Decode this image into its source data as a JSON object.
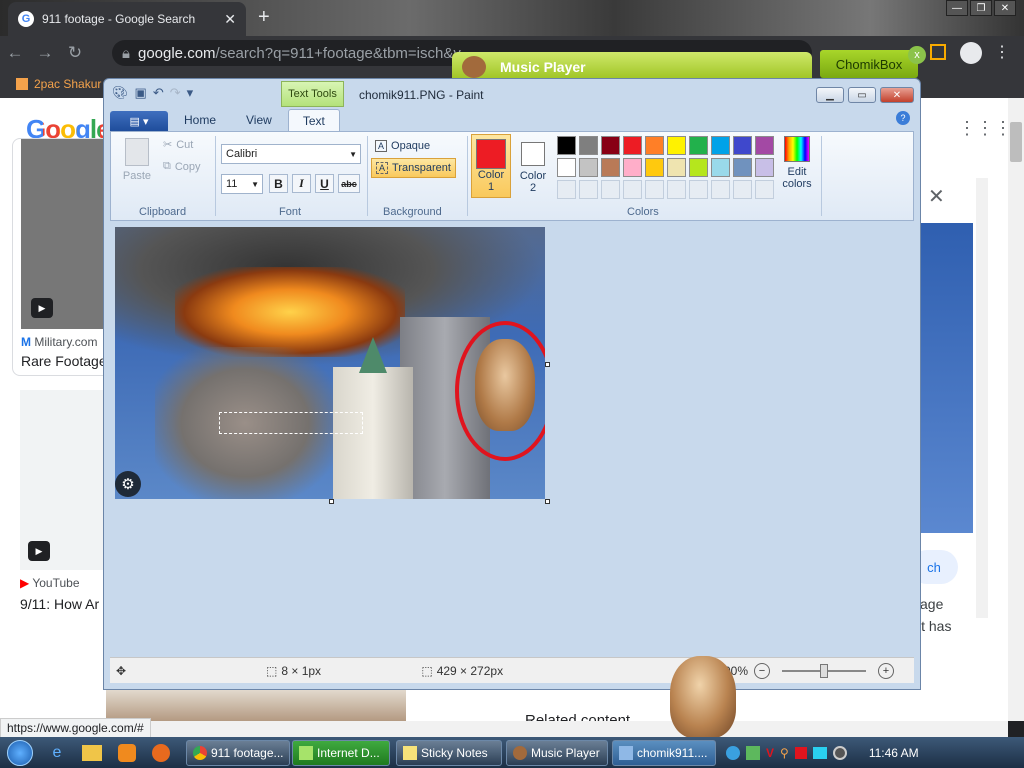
{
  "browser": {
    "tab_title": "911 footage - Google Search",
    "tab_close": "✕",
    "new_tab": "+",
    "omnibox_domain": "google.com",
    "omnibox_path": "/search?q=911+footage&tbm=isch&v...",
    "bookmark_label": "2pac Shakur",
    "status_url": "https://www.google.com/#"
  },
  "google": {
    "logo": "Google",
    "result1_source": "Military.com",
    "result1_title": "Rare Footage",
    "result2_source": "YouTube",
    "result2_title": "9/11: How Ar",
    "right_btn": "ch",
    "right_text1": "age",
    "right_text2": "it has",
    "right_text3": "Related content"
  },
  "music_player": {
    "title": "Music Player"
  },
  "chomikbox": {
    "label": "ChomikBox",
    "close": "x"
  },
  "paint": {
    "context_tab": "Text Tools",
    "title": "chomik911.PNG - Paint",
    "tabs": [
      "Home",
      "View",
      "Text"
    ],
    "clipboard": {
      "paste": "Paste",
      "cut": "Cut",
      "copy": "Copy",
      "label": "Clipboard"
    },
    "font": {
      "family": "Calibri",
      "size": "11",
      "bold": "B",
      "italic": "I",
      "underline": "U",
      "strike": "abc",
      "label": "Font"
    },
    "background": {
      "opaque": "Opaque",
      "transparent": "Transparent",
      "label": "Background"
    },
    "colors": {
      "color1_label": "Color",
      "color1_num": "1",
      "color2_label": "Color",
      "color2_num": "2",
      "edit_label": "Edit",
      "edit_label2": "colors",
      "label": "Colors",
      "color1": "#ed1c24",
      "color2": "#ffffff",
      "row1": [
        "#000000",
        "#7f7f7f",
        "#880015",
        "#ed1c24",
        "#ff7f27",
        "#fff200",
        "#22b14c",
        "#00a2e8",
        "#3f48cc",
        "#a349a4"
      ],
      "row2": [
        "#ffffff",
        "#c3c3c3",
        "#b97a57",
        "#ffaec9",
        "#ffc90e",
        "#efe4b0",
        "#b5e61d",
        "#99d9ea",
        "#7092be",
        "#c8bfe7"
      ]
    },
    "status": {
      "selection": "8 × 1px",
      "size": "429 × 272px",
      "zoom": "100%"
    }
  },
  "taskbar": {
    "items": [
      "911 footage...",
      "Internet D...",
      "Sticky Notes",
      "Music Player",
      "chomik911...."
    ],
    "clock": "11:46 AM"
  }
}
